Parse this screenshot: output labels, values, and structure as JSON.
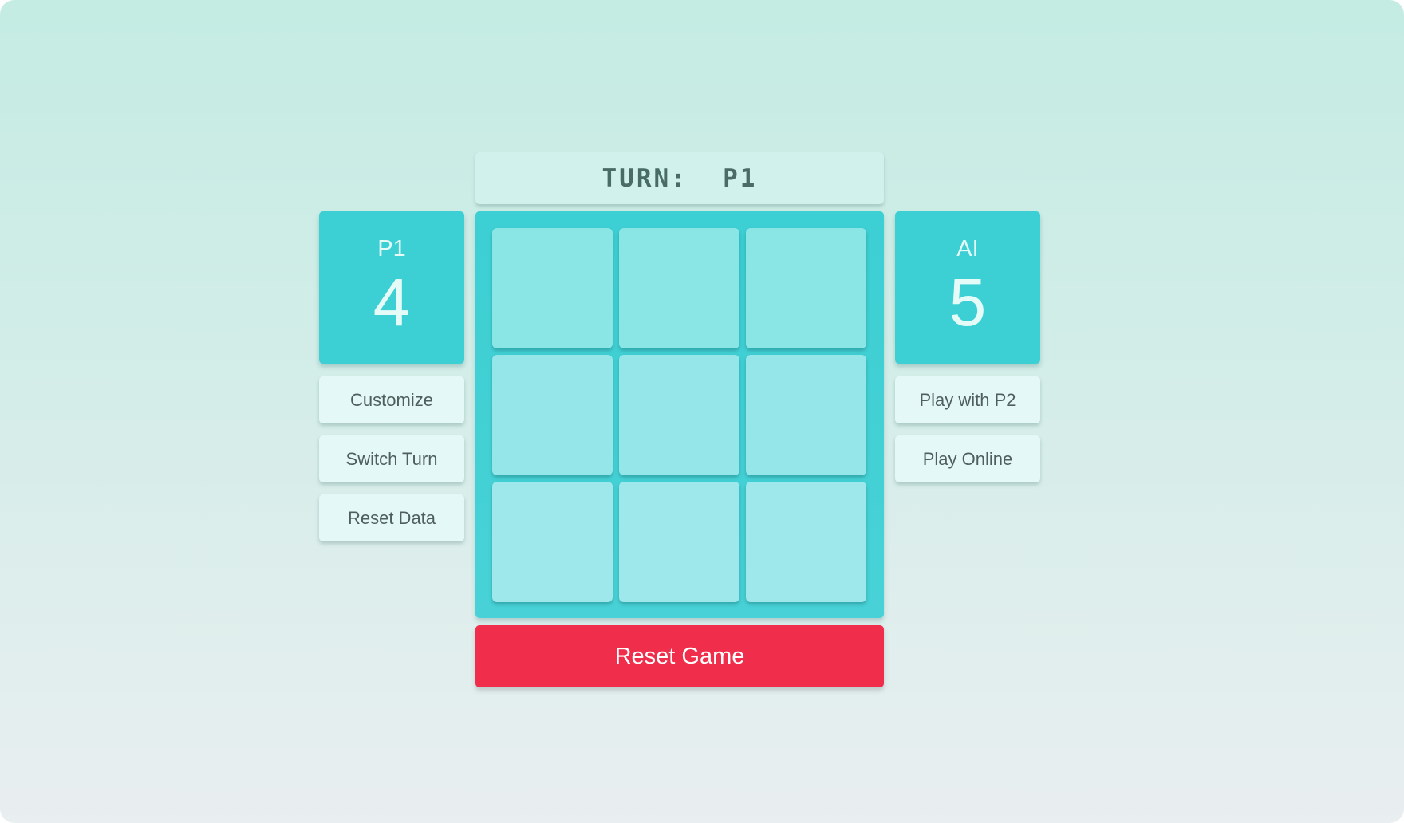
{
  "turn": {
    "text": "TURN:  P1",
    "current_player": "P1"
  },
  "players": {
    "left": {
      "name": "P1",
      "score": "4"
    },
    "right": {
      "name": "AI",
      "score": "5"
    }
  },
  "left_buttons": [
    {
      "label": "Customize"
    },
    {
      "label": "Switch Turn"
    },
    {
      "label": "Reset Data"
    }
  ],
  "right_buttons": [
    {
      "label": "Play with P2"
    },
    {
      "label": "Play Online"
    }
  ],
  "board": {
    "rows": 3,
    "cols": 3,
    "cells": [
      "",
      "",
      "",
      "",
      "",
      "",
      "",
      "",
      ""
    ]
  },
  "reset_game": {
    "label": "Reset Game"
  },
  "colors": {
    "accent_teal": "#3CCFD3",
    "cell_top": "#8AE5E5",
    "cell_bottom": "#9EE7EA",
    "danger_red": "#F02E4C",
    "button_bg": "#E4F8F7",
    "turn_bg": "#D1F1EC",
    "turn_text": "#4A6C66"
  }
}
